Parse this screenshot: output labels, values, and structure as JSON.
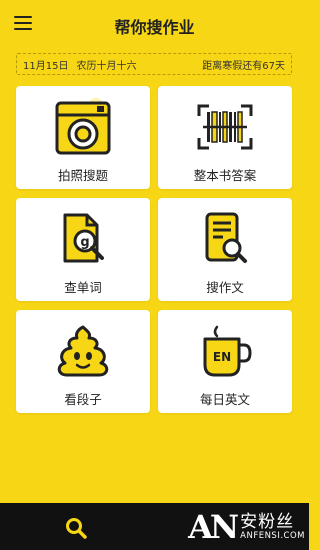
{
  "header": {
    "title": "帮你搜作业"
  },
  "info_bar": {
    "date": "11月15日",
    "lunar_date": "农历十月十六",
    "countdown": "距离寒假还有67天"
  },
  "grid": {
    "items": [
      {
        "label": "拍照搜题",
        "icon": "camera-icon"
      },
      {
        "label": "整本书答案",
        "icon": "barcode-icon"
      },
      {
        "label": "查单词",
        "icon": "word-search-icon"
      },
      {
        "label": "搜作文",
        "icon": "document-search-icon"
      },
      {
        "label": "看段子",
        "icon": "poop-emoji-icon"
      },
      {
        "label": "每日英文",
        "icon": "english-mug-icon"
      }
    ]
  },
  "bottom_bar": {
    "search_icon": "search-icon",
    "watermark": {
      "logo": "AN",
      "cn": "安粉丝",
      "en": "ANFENSI.COM"
    }
  },
  "colors": {
    "brand_yellow": "#f7d715",
    "dark": "#222222",
    "bottom": "#111111"
  }
}
